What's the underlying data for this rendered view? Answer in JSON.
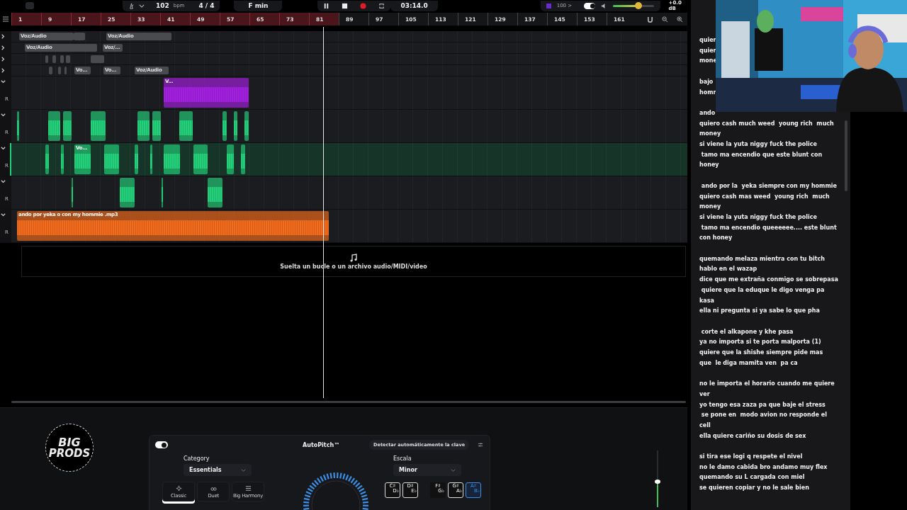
{
  "transport": {
    "tempo": "102",
    "tempo_unit": "bpm",
    "time_signature": "4 / 4",
    "key": "F min",
    "playing": true,
    "time": "03:14.0"
  },
  "master": {
    "zoom_label": "100 >",
    "monitor_on": true,
    "volume": {
      "level": 0.62
    },
    "gain_reading": "+0.0 dB"
  },
  "ruler": {
    "bars": [
      {
        "label": "1",
        "in_loop": true
      },
      {
        "label": "9",
        "in_loop": true
      },
      {
        "label": "17",
        "in_loop": true
      },
      {
        "label": "25",
        "in_loop": true
      },
      {
        "label": "33",
        "in_loop": true
      },
      {
        "label": "41",
        "in_loop": true
      },
      {
        "label": "49",
        "in_loop": true
      },
      {
        "label": "57",
        "in_loop": true
      },
      {
        "label": "65",
        "in_loop": true
      },
      {
        "label": "73",
        "in_loop": true
      },
      {
        "label": "81",
        "in_loop": true
      },
      {
        "label": "89",
        "in_loop": false
      },
      {
        "label": "97",
        "in_loop": false
      },
      {
        "label": "105",
        "in_loop": false
      },
      {
        "label": "113",
        "in_loop": false
      },
      {
        "label": "121",
        "in_loop": false
      },
      {
        "label": "129",
        "in_loop": false
      },
      {
        "label": "137",
        "in_loop": false
      },
      {
        "label": "145",
        "in_loop": false
      },
      {
        "label": "153",
        "in_loop": false
      },
      {
        "label": "161",
        "in_loop": false
      }
    ]
  },
  "tracks": [
    {
      "kind": "folder",
      "expanded": false,
      "selected": false,
      "color": "#4a4b4f",
      "clips": [
        {
          "label": "Voz/Audio"
        },
        {
          "label": "Voz/Audio"
        }
      ]
    },
    {
      "kind": "folder",
      "expanded": false,
      "selected": false,
      "color": "#4a4b4f",
      "clips": [
        {
          "label": "Voz/Audio"
        },
        {
          "label": "Voz/..."
        }
      ]
    },
    {
      "kind": "folder",
      "expanded": false,
      "selected": false,
      "color": "#4a4b4f"
    },
    {
      "kind": "folder",
      "expanded": false,
      "selected": false,
      "color": "#4a4b4f",
      "clips": [
        {
          "label": "Vo..."
        },
        {
          "label": "Vo..."
        },
        {
          "label": "Voz/Audio"
        }
      ]
    },
    {
      "kind": "audio",
      "expanded": true,
      "selected": false,
      "color": "#a31fe0",
      "side_label": "R",
      "clips": [
        {
          "label": "V..."
        }
      ]
    },
    {
      "kind": "audio",
      "expanded": true,
      "selected": false,
      "color": "#22d07a",
      "side_label": "R"
    },
    {
      "kind": "audio",
      "expanded": true,
      "selected": true,
      "color": "#22d07a",
      "side_label": "R",
      "clips": [
        {
          "label": "Vo..."
        }
      ]
    },
    {
      "kind": "audio",
      "expanded": true,
      "selected": false,
      "color": "#22d07a",
      "side_label": "R"
    },
    {
      "kind": "audio",
      "expanded": true,
      "selected": false,
      "color": "#f26a1b",
      "side_label": "R",
      "clips": [
        {
          "label": "ando por yeka o con my hommie .mp3"
        }
      ]
    }
  ],
  "drop_zone": {
    "text": "Suelta un bucle o un archivo audio/MIDI/video"
  },
  "logo": {
    "line_1": "BIG",
    "line_2": "PRODS"
  },
  "plugin": {
    "enabled": true,
    "title": "AutoPitch™",
    "auto_key_button": "Detectar automáticamente la clave",
    "category_label": "Category",
    "category_value": "Essentials",
    "modes": [
      {
        "label": "Classic",
        "selected": true
      },
      {
        "label": "Duet",
        "selected": false
      },
      {
        "label": "Big Harmony",
        "selected": false
      }
    ],
    "scale_label": "Escala",
    "scale_value": "Minor",
    "keys": [
      {
        "sharp": "C♯",
        "flat": "D♭",
        "selected": false
      },
      {
        "sharp": "D♯",
        "flat": "E♭",
        "selected": false
      },
      {
        "sharp": "F♯",
        "flat": "G♭",
        "selected": false
      },
      {
        "sharp": "G♯",
        "flat": "A♭",
        "selected": false
      },
      {
        "sharp": "A♯",
        "flat": "B♭",
        "selected": true
      }
    ]
  },
  "output_volume": {
    "level": 0.45
  },
  "lyrics": {
    "stanzas": [
      {
        "lines": [
          "quier",
          "quier",
          "mone"
        ]
      },
      {
        "lines": [
          "bajo",
          "homr"
        ]
      },
      {
        "lines": [
          "ando",
          "quiero cash much weed  young rich  much",
          "money",
          "si viene la yuta niggy fuck the police",
          " tamo ma encendio que este blunt con",
          "honey"
        ]
      },
      {
        "lines": [
          " ando por la  yeka siempre con my hommie",
          "quiero cash mas weed  young rich  much",
          "money",
          "si viene la yuta niggy fuck the police",
          " tamo ma encendio queeeeee.... este blunt",
          "con honey"
        ]
      },
      {
        "lines": [
          "quemando melaza mientra con tu bitch",
          "hablo en el wazap",
          "dice que me extraña conmigo se sobrepasa",
          " quiere que la eduque le digo venga pa",
          "kasa",
          "ella ni pregunta si ya sabe lo que pha"
        ]
      },
      {
        "lines": [
          " corte el alkapone y khe pasa",
          "ya no importa si te porta malporta (1)",
          "quiere que la shishe siempre pide mas",
          "que  le diga mamita ven  pa ca"
        ]
      },
      {
        "lines": [
          "no le importa el horario cuando me quiere",
          "ver",
          "yo tengo esa zaza pa que baje el stress",
          " se pone en  modo avion no responde el",
          "cell",
          "ella quiere cariño su dosis de sex"
        ]
      },
      {
        "lines": [
          "si tira ese logi q respete el nivel",
          "no le damo cabida bro andamo muy flex",
          "quemando su L cargada con miel",
          "se quieren copiar y no le sale bien"
        ]
      }
    ]
  }
}
